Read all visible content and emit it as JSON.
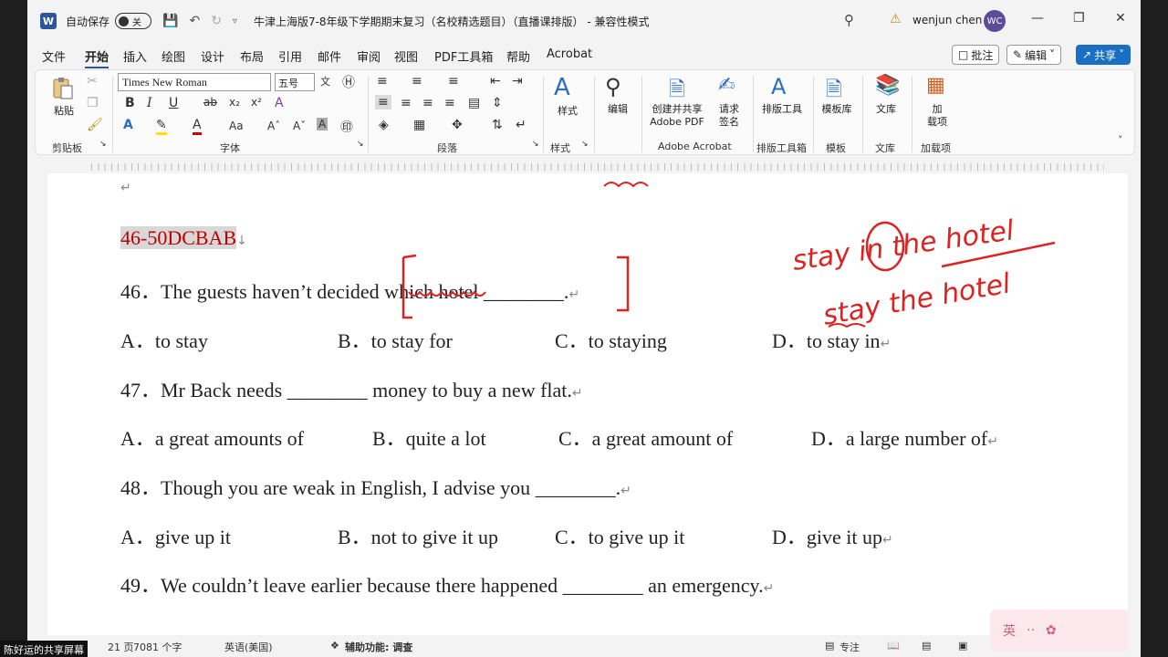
{
  "titlebar": {
    "app_icon": "W",
    "autosave_label": "自动保存",
    "autosave_state": "关",
    "doc_title": "牛津上海版7-8年级下学期期末复习（名校精选题目）（直播课排版） - 兼容性模式",
    "user_name": "wenjun chen",
    "avatar_initials": "WC"
  },
  "menu": {
    "items": [
      "文件",
      "开始",
      "插入",
      "绘图",
      "设计",
      "布局",
      "引用",
      "邮件",
      "审阅",
      "视图",
      "PDF工具箱",
      "帮助",
      "Acrobat"
    ],
    "active": "开始",
    "comment_label": "批注",
    "edit_label": "编辑",
    "share_label": "共享"
  },
  "ribbon": {
    "paste_label": "粘贴",
    "clipboard_group": "剪贴板",
    "font_name": "Times New Roman",
    "font_size": "五号",
    "font_group": "字体",
    "paragraph_group": "段落",
    "styles_label": "样式",
    "styles_group": "样式",
    "edit_label": "编辑",
    "create_share_pdf": "创建并共享\nAdobe PDF",
    "request_sign": "请求\n签名",
    "acrobat_group": "Adobe Acrobat",
    "layout_tool": "排版工具",
    "layout_group": "排版工具箱",
    "template_lib": "模板库",
    "template_group": "模板",
    "library": "文库",
    "library_group": "文库",
    "addins": "加\n载项",
    "addins_group": "加载项"
  },
  "document": {
    "answer_key": "46-50DCBAB",
    "q46": "46．The guests haven’t decided which hotel ________.",
    "q46_opts": [
      "A．to stay",
      "B．to stay for",
      "C．to staying",
      "D．to stay in"
    ],
    "q47": "47．Mr Back needs ________ money to buy a new flat.",
    "q47_opts": [
      "A．a great amounts of",
      "B．quite a lot",
      "C．a great amount of",
      "D．a large number of"
    ],
    "q48": "48．Though you are weak in English, I advise you ________.",
    "q48_opts": [
      "A．give up it",
      "B．not to give it up",
      "C．to give up it",
      "D．give it up"
    ],
    "q49": "49．We couldn’t leave earlier because there happened ________ an emergency.",
    "ink_1": "stay in the hotel",
    "ink_2": "stay the hotel"
  },
  "statusbar": {
    "page": "21 页",
    "words": "7081 个字",
    "language": "英语(美国)",
    "accessibility": "辅助功能: 调查",
    "focus": "专注"
  },
  "overlay_text": "陈好运的共享屏幕",
  "ime_label": "英"
}
